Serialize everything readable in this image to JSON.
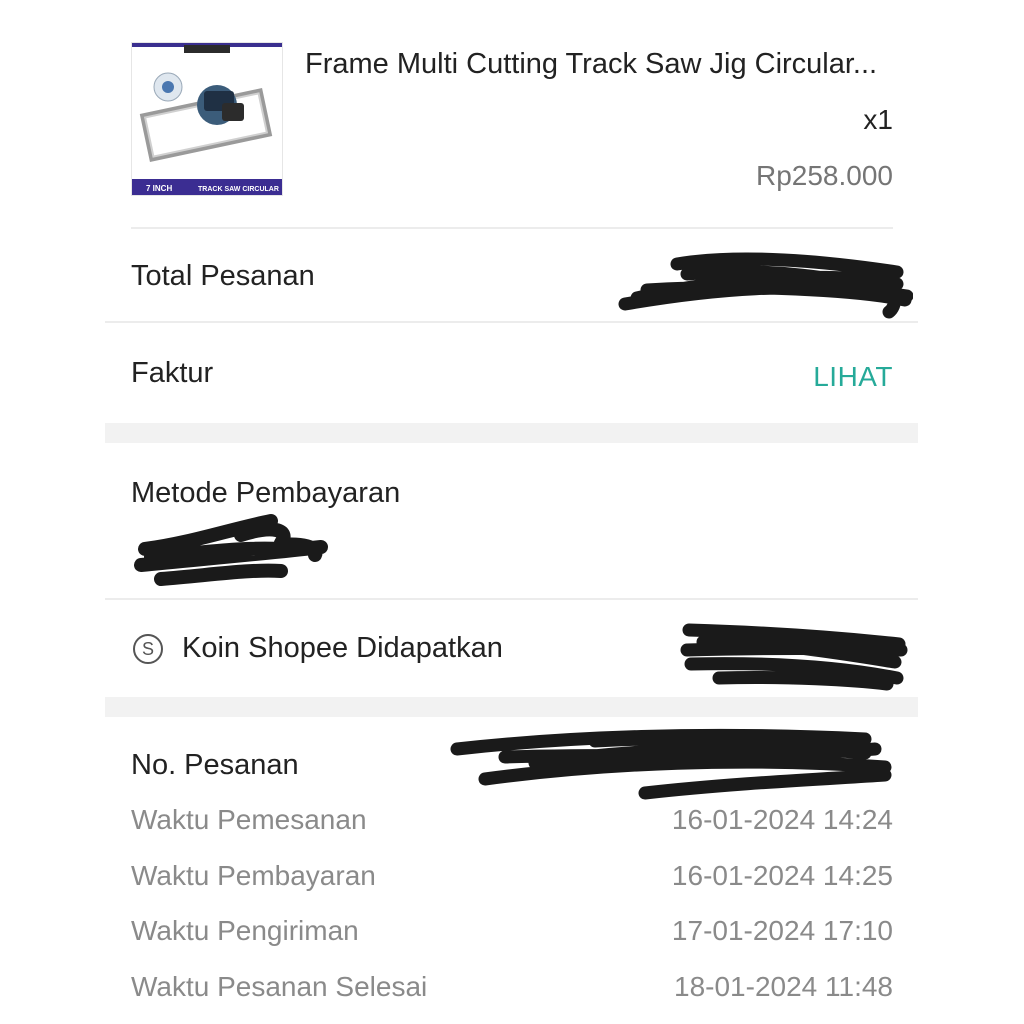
{
  "product": {
    "name": "Frame Multi Cutting Track Saw Jig Circular...",
    "quantity": "x1",
    "price": "Rp258.000",
    "thumbnail": {
      "badge_left": "7 INCH",
      "badge_right": "TRACK SAW CIRCULAR"
    }
  },
  "order_total": {
    "label": "Total Pesanan"
  },
  "invoice": {
    "label": "Faktur",
    "action": "LIHAT"
  },
  "payment": {
    "label": "Metode Pembayaran"
  },
  "coins": {
    "label": "Koin Shopee Didapatkan",
    "icon": "shopee-coin-icon",
    "icon_glyph": "S"
  },
  "order_info": {
    "number_label": "No. Pesanan",
    "rows": [
      {
        "label": "Waktu Pemesanan",
        "value": "16-01-2024 14:24"
      },
      {
        "label": "Waktu Pembayaran",
        "value": "16-01-2024 14:25"
      },
      {
        "label": "Waktu Pengiriman",
        "value": "17-01-2024 17:10"
      },
      {
        "label": "Waktu Pesanan Selesai",
        "value": "18-01-2024 11:48"
      }
    ]
  },
  "colors": {
    "accent_link": "#26aa99",
    "section_gap": "#f2f2f2",
    "redaction": "#1a1a1a"
  }
}
